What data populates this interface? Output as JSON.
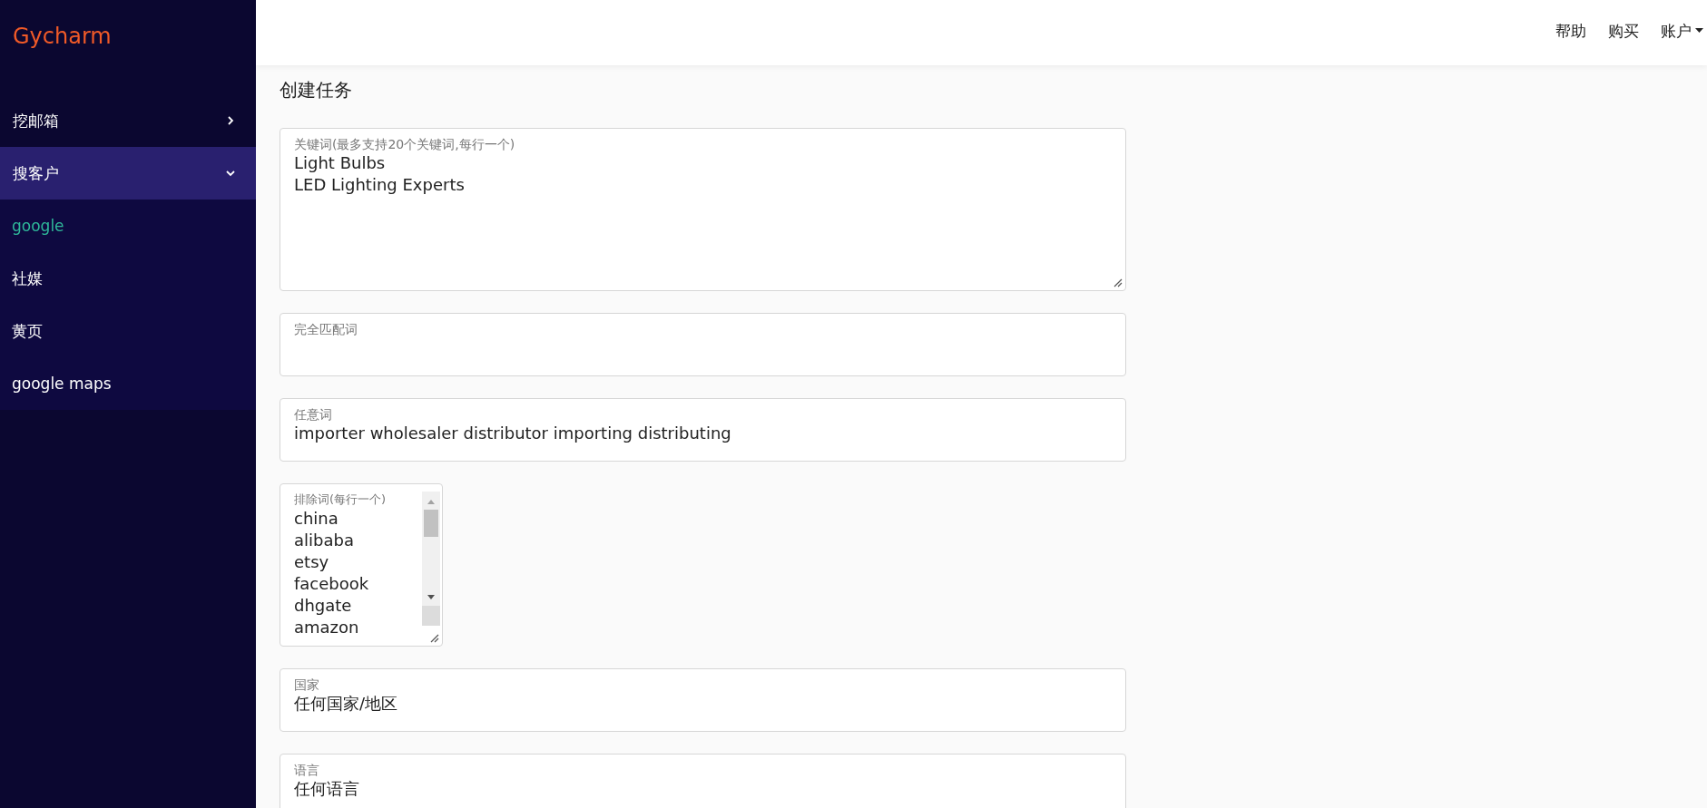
{
  "sidebar": {
    "logo": "Gycharm",
    "items": [
      {
        "kind": "group",
        "label": "挖邮箱",
        "expanded": false
      },
      {
        "kind": "group",
        "label": "搜客户",
        "expanded": true,
        "children": [
          {
            "label": "google",
            "selected": true
          },
          {
            "label": "社媒",
            "selected": false
          },
          {
            "label": "黄页",
            "selected": false
          },
          {
            "label": "google maps",
            "selected": false
          }
        ]
      }
    ]
  },
  "topbar": {
    "links": [
      {
        "label": "帮助",
        "dropdown": false
      },
      {
        "label": "购买",
        "dropdown": false
      },
      {
        "label": "账户",
        "dropdown": true
      }
    ]
  },
  "page_title": "创建任务",
  "fields": [
    {
      "kind": "textarea",
      "label": "关键词(最多支持20个关键词,每行一个)",
      "lines": [
        "Light Bulbs",
        "LED Lighting Experts"
      ]
    },
    {
      "kind": "input",
      "label": "完全匹配词"
    },
    {
      "kind": "input",
      "label": "任意词",
      "lines": [
        "importer wholesaler distributor importing distributing"
      ]
    },
    {
      "kind": "scroll",
      "label": "排除词(每行一个)",
      "lines": [
        "china",
        "alibaba",
        "etsy",
        "facebook",
        "dhgate",
        "amazon"
      ]
    },
    {
      "kind": "input",
      "label": "国家",
      "lines": [
        "任何国家/地区"
      ]
    },
    {
      "kind": "input",
      "label": "语言",
      "lines": [
        "任何语言"
      ]
    }
  ]
}
